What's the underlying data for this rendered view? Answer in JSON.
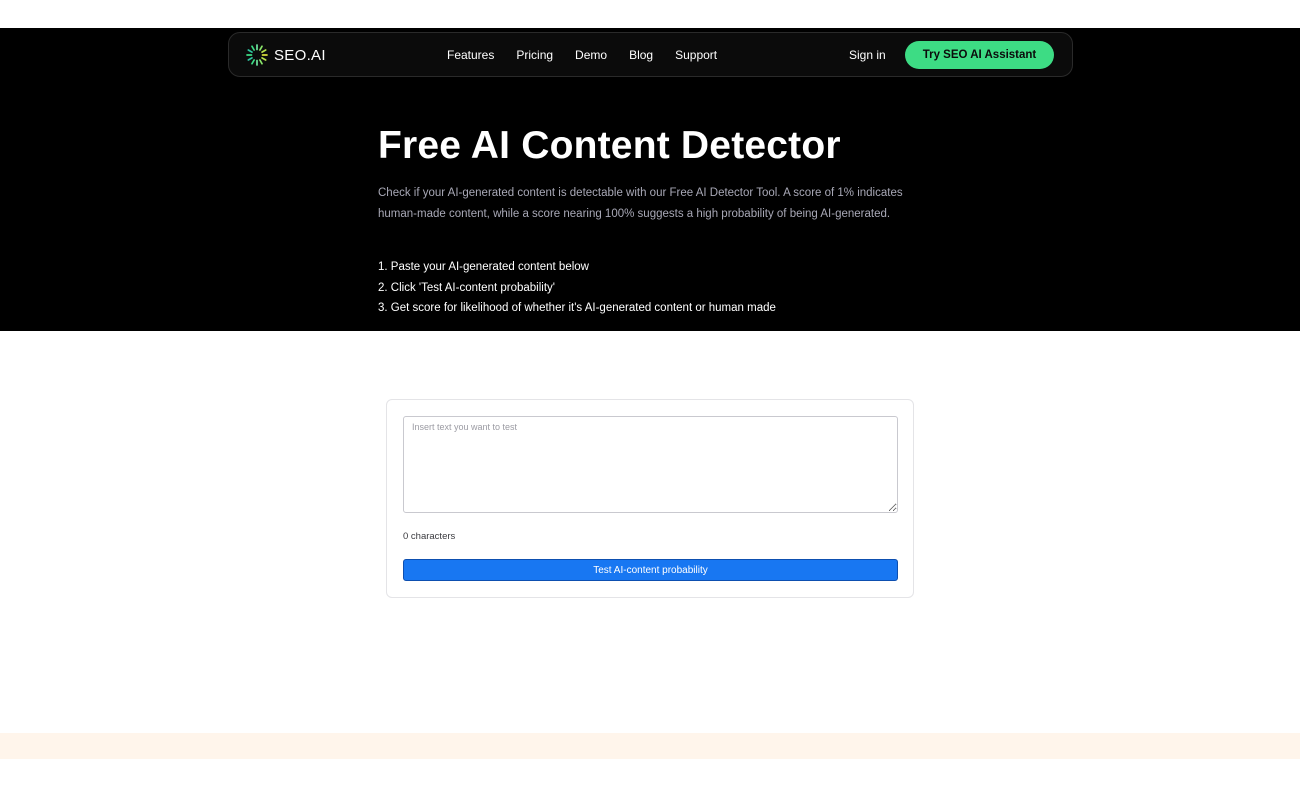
{
  "header": {
    "logo_text": "SEO.AI",
    "nav": [
      {
        "label": "Features"
      },
      {
        "label": "Pricing"
      },
      {
        "label": "Demo"
      },
      {
        "label": "Blog"
      },
      {
        "label": "Support"
      }
    ],
    "sign_in_label": "Sign in",
    "cta_label": "Try SEO AI Assistant"
  },
  "hero": {
    "title": "Free AI Content Detector",
    "description": "Check if your AI-generated content is detectable with our Free AI Detector Tool. A score of 1% indicates human-made content, while a score nearing 100% suggests a high probability of being AI-generated.",
    "steps": [
      "1. Paste your AI-generated content below",
      "2. Click 'Test AI-content probability'",
      "3. Get score for likelihood of whether it's AI-generated content or human made"
    ]
  },
  "tool": {
    "input_value": "",
    "input_placeholder": "Insert text you want to test",
    "char_count": "0 characters",
    "button_label": "Test AI-content probability"
  },
  "colors": {
    "hero_bg": "#000000",
    "cta_green": "#3ddc84",
    "button_blue": "#1877f2",
    "footer_band": "#fff5eb"
  },
  "icons": {
    "logo": "sunburst-logo-icon"
  }
}
